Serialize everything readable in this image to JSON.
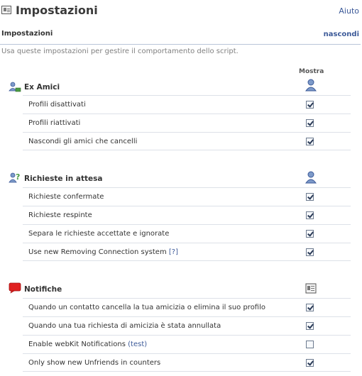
{
  "header": {
    "title": "Impostazioni",
    "help_label": "Aiuto"
  },
  "section": {
    "title": "Impostazioni",
    "hide_label": "nascondi",
    "description": "Usa queste impostazioni per gestire il comportamento dello script."
  },
  "column_header": "Mostra",
  "groups": [
    {
      "title": "Ex Amici",
      "icon": "friends-icon",
      "column_icon": "person-icon",
      "rows": [
        {
          "label": "Profili disattivati",
          "checked": true
        },
        {
          "label": "Profili riattivati",
          "checked": true
        },
        {
          "label": "Nascondi gli amici che cancelli",
          "checked": true
        }
      ]
    },
    {
      "title": "Richieste in attesa",
      "icon": "pending-requests-icon",
      "column_icon": "person-icon",
      "rows": [
        {
          "label": "Richieste confermate",
          "checked": true
        },
        {
          "label": "Richieste respinte",
          "checked": true
        },
        {
          "label": "Separa le richieste accettate e ignorate",
          "checked": true
        },
        {
          "label": "Use new Removing Connection system",
          "link": "[?]",
          "checked": true
        }
      ]
    },
    {
      "title": "Notifiche",
      "icon": "notification-bubble-icon",
      "column_icon": "settings-panel-icon",
      "rows": [
        {
          "label": "Quando un contatto cancella la tua amicizia o elimina il suo profilo",
          "checked": true
        },
        {
          "label": "Quando una tua richiesta di amicizia è stata annullata",
          "checked": true
        },
        {
          "label": "Enable webKit Notifications",
          "link": "(test)",
          "checked": false
        },
        {
          "label": "Only show new Unfriends in counters",
          "checked": true
        }
      ]
    }
  ]
}
